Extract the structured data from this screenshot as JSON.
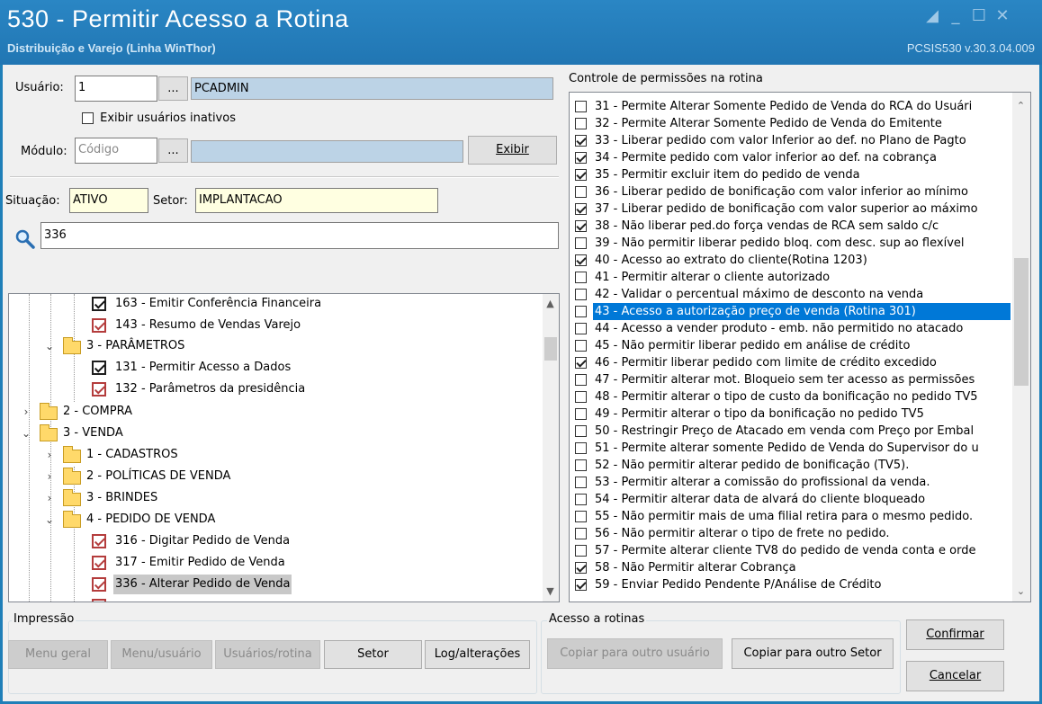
{
  "window": {
    "title": "530 - Permitir Acesso a Rotina",
    "subtitle": "Distribuição e Varejo (Linha WinThor)",
    "version": "PCSIS530  v.30.3.04.009"
  },
  "form": {
    "usuario_label": "Usuário:",
    "usuario_value": "1",
    "usuario_name": "PCADMIN",
    "lookup_btn": "...",
    "inativos_label": "Exibir usuários inativos",
    "modulo_label": "Módulo:",
    "modulo_placeholder": "Código",
    "exibir_btn": "Exibir",
    "situacao_label": "Situação:",
    "situacao_value": "ATIVO",
    "setor_label": "Setor:",
    "setor_value": "IMPLANTACAO",
    "search_value": "336"
  },
  "tree": [
    {
      "text": "163 - Emitir Conferência Financeira",
      "kind": "check",
      "color": "black"
    },
    {
      "text": "143 - Resumo de Vendas Varejo",
      "kind": "check",
      "color": "red"
    },
    {
      "text": "3 - PARÂMETROS",
      "kind": "folder",
      "expanded": true
    },
    {
      "text": "131 - Permitir Acesso a Dados",
      "kind": "check",
      "color": "black"
    },
    {
      "text": "132 - Parâmetros da presidência",
      "kind": "check",
      "color": "red"
    },
    {
      "text": "2 - COMPRA",
      "kind": "folder",
      "expanded": false
    },
    {
      "text": "3 - VENDA",
      "kind": "folder",
      "expanded": true
    },
    {
      "text": "1 - CADASTROS",
      "kind": "folder",
      "expanded": false
    },
    {
      "text": "2 - POLÍTICAS DE VENDA",
      "kind": "folder",
      "expanded": false
    },
    {
      "text": "3 - BRINDES",
      "kind": "folder",
      "expanded": false
    },
    {
      "text": "4 - PEDIDO DE VENDA",
      "kind": "folder",
      "expanded": true
    },
    {
      "text": "316 - Digitar Pedido de Venda",
      "kind": "check",
      "color": "red"
    },
    {
      "text": "317 - Emitir Pedido de Venda",
      "kind": "check",
      "color": "red"
    },
    {
      "text": "336 - Alterar Pedido de Venda",
      "kind": "check",
      "color": "red",
      "selected": true
    }
  ],
  "permissions": {
    "title": "Controle de permissões na rotina",
    "items": [
      {
        "text": "31 - Permite Alterar Somente Pedido de Venda do RCA do Usuári",
        "checked": false
      },
      {
        "text": "32 - Permite Alterar Somente Pedido de Venda do Emitente",
        "checked": false
      },
      {
        "text": "33 - Liberar pedido com valor Inferior ao def. no Plano de Pagto",
        "checked": true
      },
      {
        "text": "34 - Permite pedido com valor inferior ao def. na cobrança",
        "checked": true
      },
      {
        "text": "35 - Permitir excluir item do pedido de venda",
        "checked": true
      },
      {
        "text": "36 - Liberar pedido de bonificação com valor inferior ao mínimo",
        "checked": false
      },
      {
        "text": "37 - Liberar pedido de bonificação com valor superior ao máximo",
        "checked": true
      },
      {
        "text": "38 - Não liberar ped.do força vendas de RCA sem saldo c/c",
        "checked": true
      },
      {
        "text": "39 - Não permitir liberar pedido bloq. com desc. sup ao flexível",
        "checked": false
      },
      {
        "text": "40 - Acesso ao extrato do cliente(Rotina 1203)",
        "checked": true
      },
      {
        "text": "41 - Permitir alterar o cliente autorizado",
        "checked": false
      },
      {
        "text": "42 - Validar o percentual máximo de desconto na venda",
        "checked": false
      },
      {
        "text": "43 - Acesso a autorização preço de venda (Rotina 301)",
        "checked": false,
        "selected": true
      },
      {
        "text": "44 - Acesso a vender produto - emb. não permitido no atacado",
        "checked": false
      },
      {
        "text": "45 - Não permitir liberar pedido em análise de crédito",
        "checked": false
      },
      {
        "text": "46 - Permitir liberar pedido com limite de crédito excedido",
        "checked": true
      },
      {
        "text": "47 - Permitir alterar mot. Bloqueio sem ter acesso as permissões",
        "checked": false
      },
      {
        "text": "48 - Permitir alterar o tipo de custo da bonificação no pedido TV5",
        "checked": false
      },
      {
        "text": "49 - Permitir alterar o tipo da bonificação no pedido TV5",
        "checked": false
      },
      {
        "text": "50 - Restringir Preço de Atacado em venda com Preço por Embal",
        "checked": false
      },
      {
        "text": "51 - Permite alterar somente Pedido de Venda do Supervisor do u",
        "checked": false
      },
      {
        "text": "52 - Não permitir alterar pedido de bonificação (TV5).",
        "checked": false
      },
      {
        "text": "53 - Permitir alterar a comissão do profissional da venda.",
        "checked": false
      },
      {
        "text": "54 - Permitir alterar data de alvará do cliente bloqueado",
        "checked": false
      },
      {
        "text": "55 - Não permitir mais de uma filial retira para o mesmo pedido.",
        "checked": false
      },
      {
        "text": "56 - Não permitir alterar o tipo de frete no pedido.",
        "checked": false
      },
      {
        "text": "57 - Permite alterar cliente TV8 do pedido de venda conta e orde",
        "checked": false
      },
      {
        "text": "58 - Não Permitir alterar Cobrança",
        "checked": true
      },
      {
        "text": "59 - Enviar Pedido Pendente P/Análise de Crédito",
        "checked": true
      }
    ]
  },
  "impressao": {
    "title": "Impressão",
    "menu_geral": "Menu geral",
    "menu_usuario": "Menu/usuário",
    "usuarios_rotina": "Usuários/rotina",
    "setor": "Setor",
    "log": "Log/alterações"
  },
  "acesso": {
    "title": "Acesso a rotinas",
    "copiar_usuario": "Copiar para outro usuário",
    "copiar_setor": "Copiar para outro Setor"
  },
  "actions": {
    "confirmar": "Confirmar",
    "cancelar": "Cancelar"
  }
}
